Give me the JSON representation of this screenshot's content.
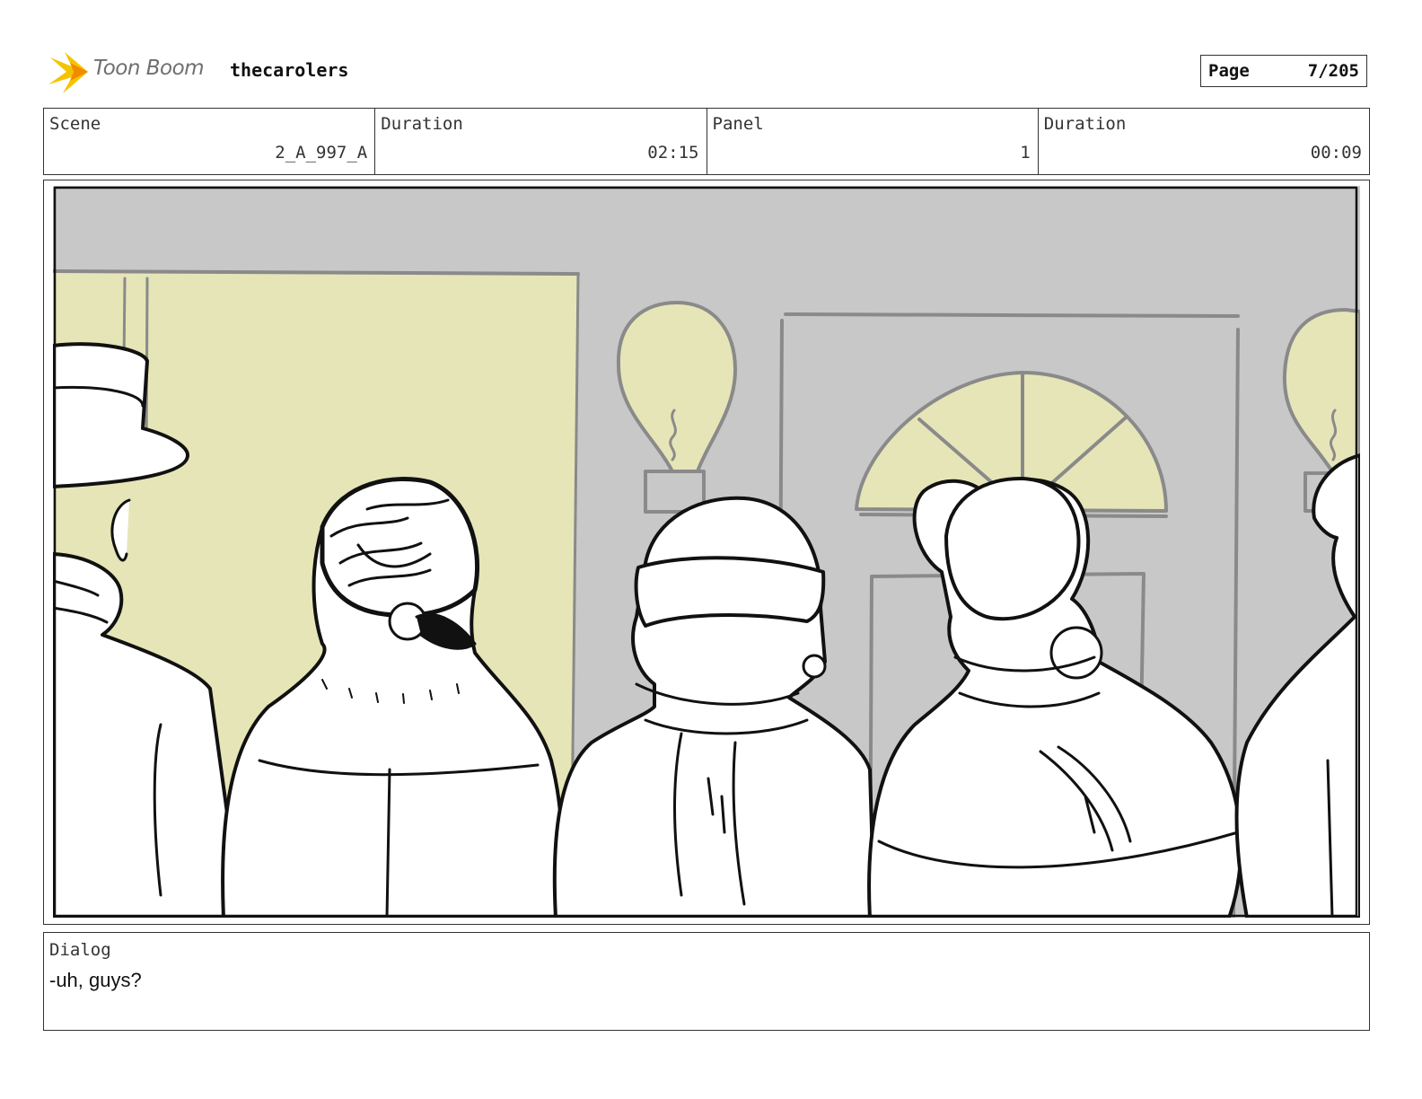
{
  "header": {
    "logo_text": "Toon Boom",
    "project_title": "thecarolers",
    "page_label": "Page",
    "page_value": "7/205"
  },
  "info": {
    "scene_label": "Scene",
    "scene_value": "2_A_997_A",
    "scene_duration_label": "Duration",
    "scene_duration_value": "02:15",
    "panel_label": "Panel",
    "panel_value": "1",
    "panel_duration_label": "Duration",
    "panel_duration_value": "00:09"
  },
  "dialog": {
    "label": "Dialog",
    "text": "-uh, guys?"
  },
  "colors": {
    "wall": "#c8c8c8",
    "warm_light": "#e5e5b8",
    "line": "#111111",
    "structure_line": "#8a8a8a"
  }
}
